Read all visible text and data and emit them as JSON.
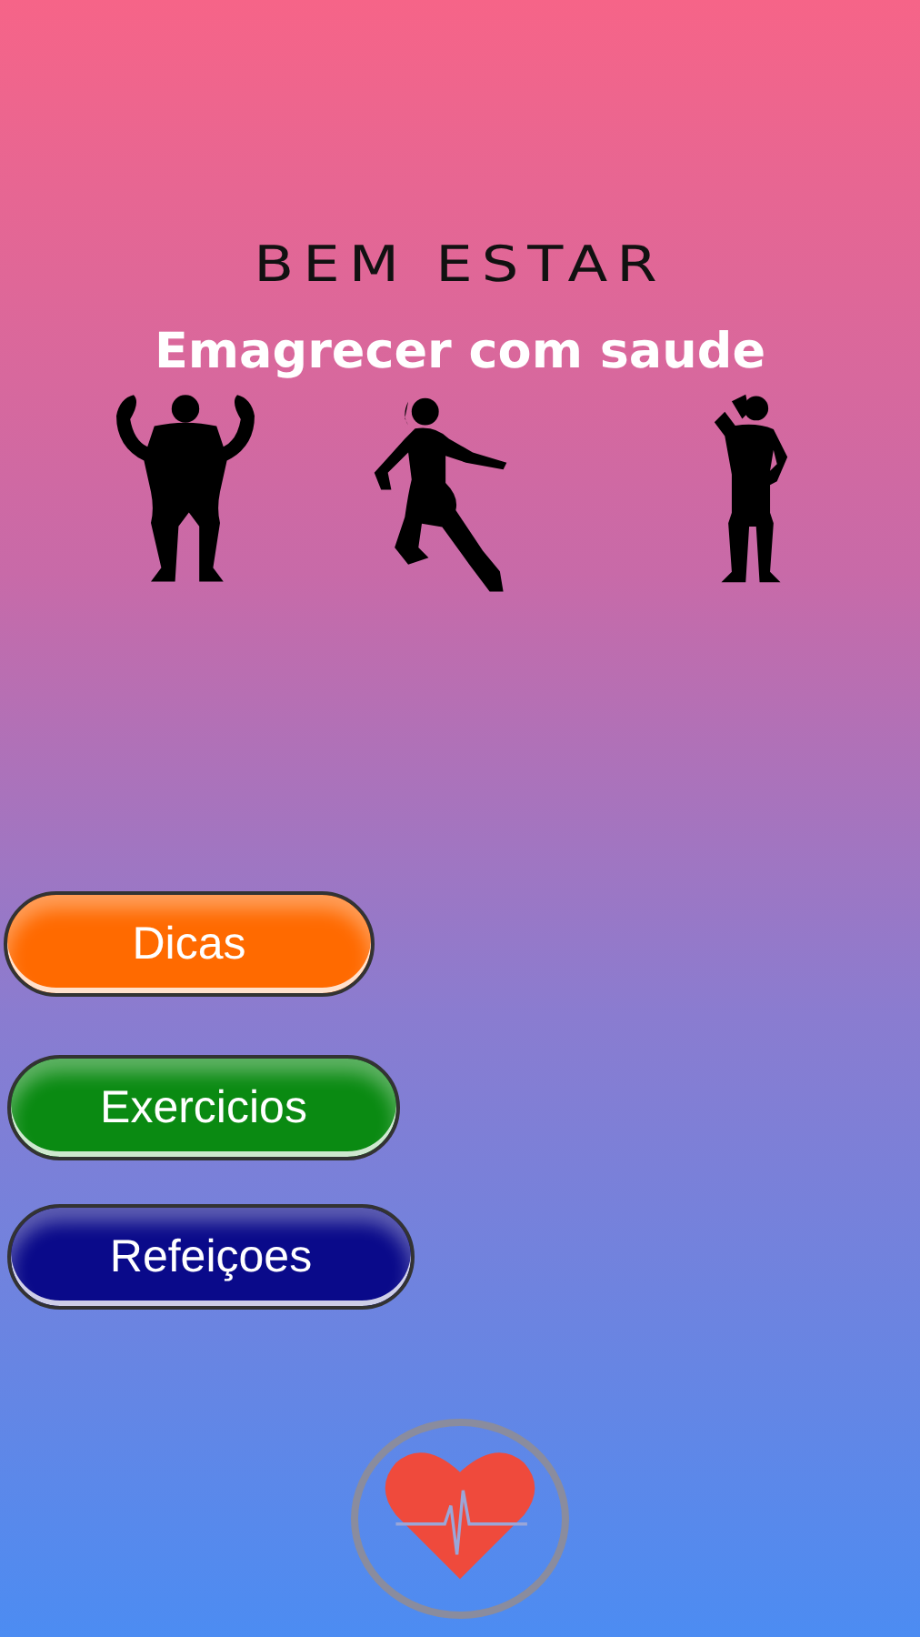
{
  "header": {
    "title": "BEM ESTAR",
    "subtitle": "Emagrecer com saude"
  },
  "menu": [
    {
      "label": "Dicas",
      "color": "#ff6a00"
    },
    {
      "label": "Exercicios",
      "color": "#0a8a12"
    },
    {
      "label": "Refeiçoes",
      "color": "#0a0a8a"
    }
  ]
}
